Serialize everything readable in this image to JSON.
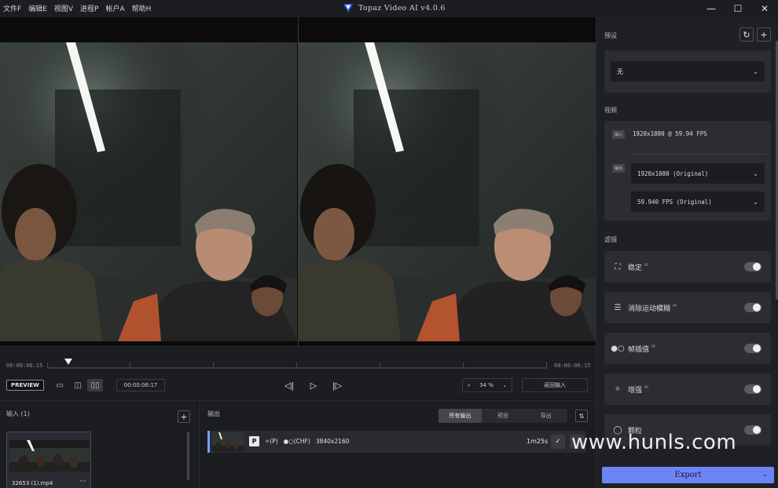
{
  "menu": [
    "文件F",
    "编辑E",
    "视图V",
    "进程P",
    "帐户A",
    "帮助H"
  ],
  "app_title": "Topaz Video AI   v4.0.6",
  "window": {
    "minimize": "—",
    "maximize": "☐",
    "close": "✕"
  },
  "timeline": {
    "start_tc": "00:00:06:15",
    "end_tc": "00:00:06:15",
    "preview_label": "PREVIEW",
    "current_time": "00:00:06:17",
    "zoom_value": "34 %",
    "return_label": "返回输入"
  },
  "inputs": {
    "title": "输入 (1)",
    "add": "+",
    "file_name": "32653 (1).mp4",
    "more": "···"
  },
  "outputs": {
    "title": "输出",
    "tabs": [
      "所有输出",
      "预览",
      "导出"
    ],
    "active_tab": "所有输出",
    "sort": "⇅",
    "row": {
      "badge": "P",
      "model1": "✧(P)",
      "model2": "●○(CHF)",
      "resolution": "3840x2160",
      "duration": "1m25s",
      "check": "✓"
    }
  },
  "sidebar": {
    "preset_label": "预设",
    "preset_value": "无",
    "video_label": "视频",
    "input_tag": "输入",
    "input_res": "1920x1080 @ 59.94 FPS",
    "output_tag": "输出",
    "output_res": "1920x1080 (Original)",
    "output_fps": "59.940 FPS (Original)",
    "filters_label": "滤镜",
    "filters": [
      {
        "label": "稳定",
        "icon": "stabilize-icon",
        "ai": "AI"
      },
      {
        "label": "消除运动模糊",
        "icon": "motion-deblur-icon",
        "ai": "AI"
      },
      {
        "label": "帧插值",
        "icon": "frame-interpolation-icon",
        "ai": "AI"
      },
      {
        "label": "增强",
        "icon": "enhance-icon",
        "ai": "AI"
      },
      {
        "label": "颗粒",
        "icon": "grain-icon",
        "ai": ""
      }
    ],
    "export_label": "Export"
  },
  "watermark": "www.hunls.com",
  "colors": {
    "accent": "#6d84f7",
    "active_row_bar": "#6fa2ff",
    "background": "#16171b"
  }
}
